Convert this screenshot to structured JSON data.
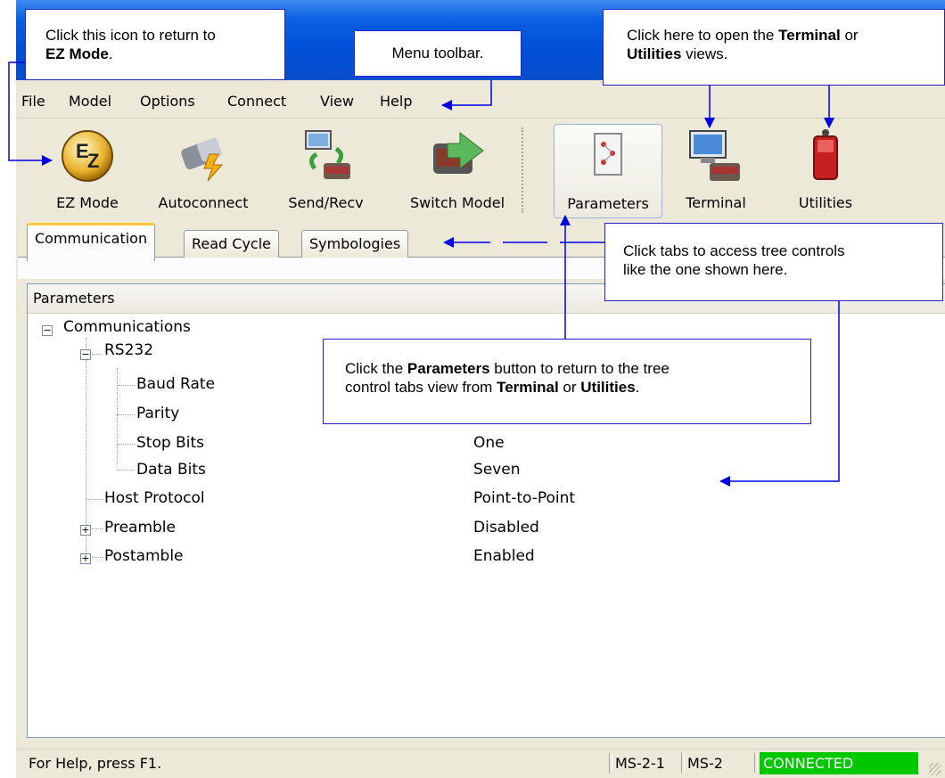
{
  "menu": [
    "File",
    "Model",
    "Options",
    "Connect",
    "View",
    "Help"
  ],
  "toolbar": [
    {
      "label": "EZ Mode",
      "icon": "ez-mode-icon"
    },
    {
      "label": "Autoconnect",
      "icon": "autoconnect-icon"
    },
    {
      "label": "Send/Recv",
      "icon": "send-recv-icon"
    },
    {
      "label": "Switch Model",
      "icon": "switch-model-icon"
    },
    {
      "label": "Parameters",
      "icon": "parameters-icon"
    },
    {
      "label": "Terminal",
      "icon": "terminal-icon"
    },
    {
      "label": "Utilities",
      "icon": "utilities-icon"
    }
  ],
  "tabs": [
    "Communication",
    "Read Cycle",
    "Symbologies"
  ],
  "tree": {
    "header": "Parameters",
    "rows": [
      {
        "label": "Communications",
        "value": ""
      },
      {
        "label": "RS232",
        "value": ""
      },
      {
        "label": "Baud Rate",
        "value": ""
      },
      {
        "label": "Parity",
        "value": ""
      },
      {
        "label": "Stop Bits",
        "value": "One"
      },
      {
        "label": "Data Bits",
        "value": "Seven"
      },
      {
        "label": "Host Protocol",
        "value": "Point-to-Point"
      },
      {
        "label": "Preamble",
        "value": "Disabled"
      },
      {
        "label": "Postamble",
        "value": "Enabled"
      }
    ]
  },
  "status": {
    "help": "For Help, press F1.",
    "model1": "MS-2-1",
    "model2": "MS-2",
    "connection": "CONNECTED",
    "connection_color": "#00c800"
  },
  "callouts": {
    "ez_mode": {
      "text": "Click this icon to return to",
      "bold": "EZ Mode",
      "end": "."
    },
    "menu_toolbar": {
      "text": "Menu toolbar."
    },
    "terminal_utilities": {
      "pre": "Click here to open the",
      "bold1": "Terminal",
      "mid": "or",
      "bold2": "Utilities",
      "end": "views."
    },
    "tabs": {
      "line1": "Click tabs to access tree controls",
      "line2": "like the one shown here."
    },
    "parameters": {
      "pre": "Click the",
      "bold1": "Parameters",
      "mid1": "button to return to the tree",
      "line2": "control tabs view from",
      "bold2": "Terminal",
      "mid2": "or",
      "bold3": "Utilities",
      "end": "."
    }
  },
  "colors": {
    "title_bar": "#0050d8",
    "callout_border": "#2323d2",
    "arrow": "#0000e6"
  }
}
